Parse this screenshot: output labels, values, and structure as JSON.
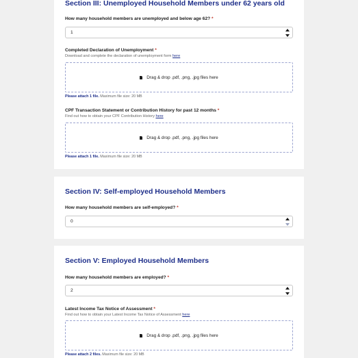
{
  "section3": {
    "title": "Section III: Unemployed Household Members under 62 years old",
    "q_unemployed": {
      "label": "How many household members are unemployed and below age 62?",
      "required": "*",
      "value": "1"
    },
    "decl": {
      "label": "Completed Declaration of Unemployment",
      "required": "*",
      "help_text": "Download and complete the declaration of unemployment form",
      "help_link": "here",
      "dropzone": "Drag & drop .pdf, .png, .jpg files here",
      "note_bold": "Please attach 1 file.",
      "note_rest": "Maximum file size: 20 MB"
    },
    "cpf": {
      "label": "CPF Transaction Statement or Contribution History for past 12 months",
      "required": "*",
      "help_text": "Find out how to obtain your CPF Contribution History",
      "help_link": "here",
      "dropzone": "Drag & drop .pdf, .png, .jpg files here",
      "note_bold": "Please attach 1 file.",
      "note_rest": "Maximum file size: 20 MB"
    }
  },
  "section4": {
    "title": "Section IV: Self-employed Household Members",
    "q_self": {
      "label": "How many household members are self-employed?",
      "required": "*",
      "value": "0"
    }
  },
  "section5": {
    "title": "Section V: Employed Household Members",
    "q_employed": {
      "label": "How many household members are employed?",
      "required": "*",
      "value": "2"
    },
    "tax": {
      "label": "Latest Income Tax Notice of Assessment",
      "required": "*",
      "help_text": "Find out how to obtain your Latest Income Tax Notice of Assessment",
      "help_link": "here",
      "dropzone": "Drag & drop .pdf, .png, .jpg files here",
      "note_bold": "Please attach 2 files.",
      "note_rest": "Maximum file size: 20 MB"
    }
  },
  "colors": {
    "heading": "#1e2f8a",
    "required": "#c0392b",
    "link": "#1e2f8a",
    "dropzone_border": "#9aa3d0"
  },
  "icons": {
    "file": "file-icon",
    "stepper": "chevron-up-down-icon"
  }
}
